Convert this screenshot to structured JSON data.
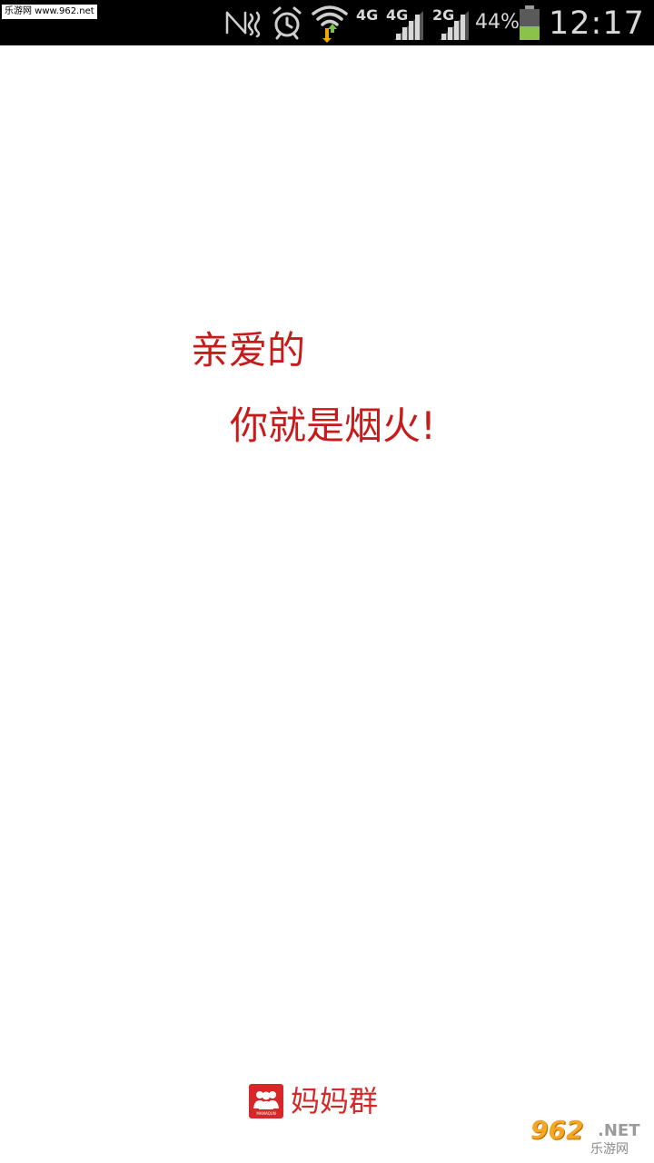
{
  "status_bar": {
    "watermark": "乐游网 www.962.net",
    "icons": [
      "nfc-icon",
      "alarm-icon",
      "wifi-icon",
      "signal-icon",
      "signal-icon",
      "signal-icon",
      "battery-icon"
    ],
    "network_labels": [
      "4G",
      "4G",
      "2G"
    ],
    "battery_percent": "44%",
    "battery_level": 0.44,
    "time": "12:17"
  },
  "splash": {
    "greeting": "亲爱的",
    "tagline": "你就是烟火!"
  },
  "brand": {
    "logo_text": "MAMAQUN",
    "name": "妈妈群"
  },
  "watermark_bottom": {
    "number": "962",
    "suffix": ".NET",
    "chinese": "乐游网"
  },
  "colors": {
    "accent": "#c81a1a",
    "brand": "#d62828",
    "status_bar_bg": "#000000",
    "battery_fill": "#8bc34a"
  }
}
